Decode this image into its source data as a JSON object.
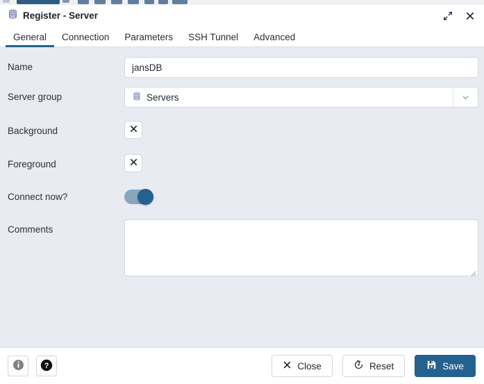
{
  "background_app": {
    "name": "underlying-toolbar-strip"
  },
  "titlebar": {
    "icon": "server-database-icon",
    "title": "Register - Server",
    "maximize_icon": "maximize-diagonal-icon",
    "close_icon": "close-x-icon"
  },
  "tabs": [
    {
      "label": "General",
      "active": true
    },
    {
      "label": "Connection",
      "active": false
    },
    {
      "label": "Parameters",
      "active": false
    },
    {
      "label": "SSH Tunnel",
      "active": false
    },
    {
      "label": "Advanced",
      "active": false
    }
  ],
  "form": {
    "name": {
      "label": "Name",
      "value": "jansDB",
      "placeholder": ""
    },
    "server_group": {
      "label": "Server group",
      "value": "Servers",
      "icon": "server-group-icon",
      "arrow_icon": "chevron-down-icon"
    },
    "background": {
      "label": "Background",
      "clear_icon": "clear-x-icon"
    },
    "foreground": {
      "label": "Foreground",
      "clear_icon": "clear-x-icon"
    },
    "connect_now": {
      "label": "Connect now?",
      "state": "on"
    },
    "comments": {
      "label": "Comments",
      "value": "",
      "placeholder": ""
    }
  },
  "footer": {
    "info_icon": "info-circle-icon",
    "help_icon": "help-circle-icon",
    "close": {
      "label": "Close",
      "icon": "close-x-icon"
    },
    "reset": {
      "label": "Reset",
      "icon": "reset-circular-arrow-icon"
    },
    "save": {
      "label": "Save",
      "icon": "save-floppy-icon"
    }
  },
  "colors": {
    "accent": "#23618e",
    "body_background": "#e8ebf2",
    "panel": "#ffffff",
    "border": "#d3d7de",
    "text": "#24282e",
    "toggle_track": "#8aa6bf",
    "toggle_knob": "#23618e",
    "db_icon": "#9a9ec4"
  }
}
